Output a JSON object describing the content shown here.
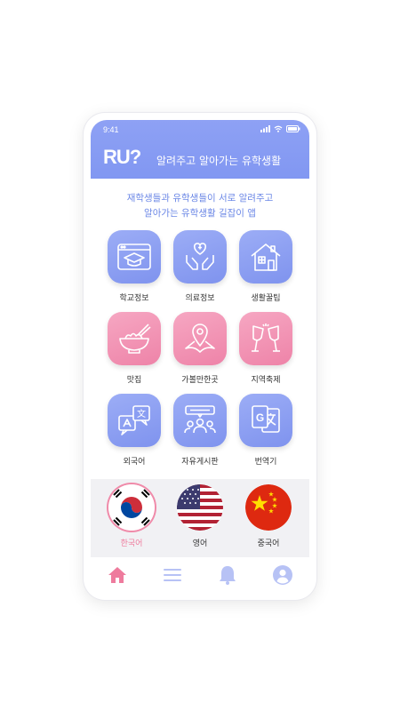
{
  "status_bar": {
    "time": "9:41"
  },
  "header": {
    "logo": "RU?",
    "tagline": "알려주고 알아가는 유학생활"
  },
  "intro": {
    "line1": "재학생들과 유학생들이 서로 알려주고",
    "line2": "알아가는 유학생활 길잡이 앱"
  },
  "menu": [
    {
      "label": "학교정보",
      "icon": "graduation-cap-browser-icon",
      "color": "blue"
    },
    {
      "label": "의료정보",
      "icon": "medical-hands-icon",
      "color": "blue"
    },
    {
      "label": "생활꿀팁",
      "icon": "house-icon",
      "color": "blue"
    },
    {
      "label": "맛집",
      "icon": "noodle-bowl-icon",
      "color": "pink"
    },
    {
      "label": "가볼만한곳",
      "icon": "map-pin-icon",
      "color": "pink"
    },
    {
      "label": "지역축제",
      "icon": "wine-glasses-icon",
      "color": "pink"
    },
    {
      "label": "외국어",
      "icon": "language-chat-icon",
      "color": "blue"
    },
    {
      "label": "자유게시판",
      "icon": "community-board-icon",
      "color": "blue"
    },
    {
      "label": "번역기",
      "icon": "translate-icon",
      "color": "blue"
    }
  ],
  "languages": [
    {
      "label": "한국어",
      "flag": "korea-flag-icon",
      "active": true
    },
    {
      "label": "영어",
      "flag": "usa-flag-icon",
      "active": false
    },
    {
      "label": "중국어",
      "flag": "china-flag-icon",
      "active": false
    }
  ],
  "nav": [
    {
      "name": "home",
      "icon": "home-icon",
      "active": true
    },
    {
      "name": "menu",
      "icon": "menu-icon",
      "active": false
    },
    {
      "name": "notifications",
      "icon": "bell-icon",
      "active": false
    },
    {
      "name": "profile",
      "icon": "profile-icon",
      "active": false
    }
  ],
  "colors": {
    "header": "#8197f2",
    "tile_blue": "#8a9ef2",
    "tile_pink": "#f093b4",
    "accent_pink": "#ee7b9d",
    "nav_inactive": "#b7c2f5",
    "subtitle": "#6b87e6"
  }
}
